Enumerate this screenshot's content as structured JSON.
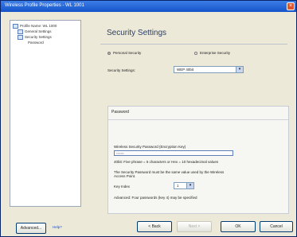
{
  "window": {
    "title": "Wireless Profile Properties - WL 1001"
  },
  "tree": {
    "items": [
      {
        "label": "Profile Name: WL 1000"
      },
      {
        "label": "General Settings"
      },
      {
        "label": "Security Settings"
      },
      {
        "label": "Password"
      }
    ]
  },
  "main": {
    "heading": "Security Settings",
    "radio_personal": "Personal Security",
    "radio_enterprise": "Enterprise Security",
    "security_label": "Security Settings:",
    "security_value": "WEP 40bit",
    "password_group_title": "Password",
    "password_field_label": "Wireless Security Password (Encryption Key)",
    "password_field_value": "•••••••",
    "hint": "40bit: Five phrase = 5 characters or Hex = 10 hexadecimal values",
    "note": "The Security Password must be the same value used by the Wireless Access Point.",
    "key_index_label": "Key Index",
    "key_index_value": "1",
    "advanced_note": "Advanced: Four passwords (key 4) may be specified"
  },
  "footer": {
    "advanced_button": "Advanced...",
    "help_link": "Help?",
    "back_button": "< Back",
    "next_button": "Next >",
    "ok_button": "OK",
    "cancel_button": "Cancel"
  }
}
